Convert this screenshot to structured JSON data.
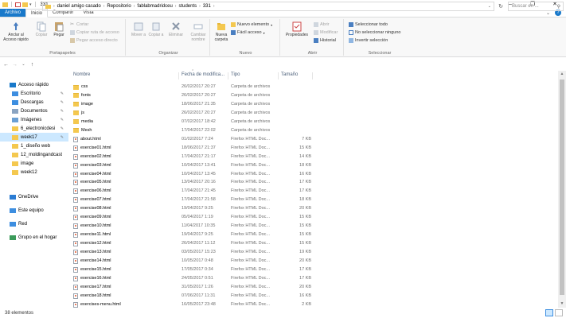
{
  "titlebar": {
    "title": "331",
    "minimize": "–",
    "maximize": "❐",
    "close": "✕"
  },
  "tabs": [
    "Archivo",
    "Inicio",
    "Compartir",
    "Vista"
  ],
  "ribbon": {
    "portapapeles": {
      "label": "Portapapeles",
      "anclar": "Anclar al Acceso rápido",
      "copiar": "Copiar",
      "pegar": "Pegar",
      "cortar": "Cortar",
      "copiar_ruta": "Copiar ruta de acceso",
      "pegar_acceso": "Pegar acceso directo"
    },
    "organizar": {
      "label": "Organizar",
      "mover": "Mover a",
      "copiar": "Copiar a",
      "eliminar": "Eliminar",
      "cambiar": "Cambiar nombre"
    },
    "nuevo": {
      "label": "Nuevo",
      "nueva_carpeta": "Nueva carpeta",
      "nuevo_elemento": "Nuevo elemento",
      "facil_acceso": "Fácil acceso"
    },
    "abrir": {
      "label": "Abrir",
      "propiedades": "Propiedades",
      "abrir": "Abrir",
      "modificar": "Modificar",
      "historial": "Historial"
    },
    "seleccionar": {
      "label": "Seleccionar",
      "todo": "Seleccionar todo",
      "ninguno": "No seleccionar ninguno",
      "invertir": "Invertir selección"
    }
  },
  "address": {
    "crumbs": [
      "daniel amigo casado",
      "Repositorio",
      "fablabmadridceu",
      "students",
      "331"
    ],
    "search_placeholder": "Buscar en ..."
  },
  "nav": [
    {
      "label": "Acceso rápido",
      "icon": "star-icon",
      "pin": false
    },
    {
      "label": "Escritorio",
      "icon": "desktop-icon",
      "pin": true
    },
    {
      "label": "Descargas",
      "icon": "download-icon",
      "pin": true
    },
    {
      "label": "Documentos",
      "icon": "documents-icon",
      "pin": true
    },
    {
      "label": "Imágenes",
      "icon": "pictures-icon",
      "pin": true
    },
    {
      "label": "6_electronicdesi",
      "icon": "folder-icon",
      "pin": true
    },
    {
      "label": "week17",
      "icon": "folder-icon",
      "pin": true,
      "selected": true
    },
    {
      "label": "1_diseño web",
      "icon": "folder-icon",
      "pin": false
    },
    {
      "label": "12_moldingandcast",
      "icon": "folder-icon",
      "pin": false
    },
    {
      "label": "image",
      "icon": "folder-icon",
      "pin": false
    },
    {
      "label": "week12",
      "icon": "folder-icon",
      "pin": false
    },
    {
      "label": "OneDrive",
      "icon": "cloud-icon",
      "pin": false
    },
    {
      "label": "Este equipo",
      "icon": "computer-icon",
      "pin": false
    },
    {
      "label": "Red",
      "icon": "network-icon",
      "pin": false
    },
    {
      "label": "Grupo en el hogar",
      "icon": "homegroup-icon",
      "pin": false
    }
  ],
  "columns": {
    "name": "Nombre",
    "date": "Fecha de modifica...",
    "type": "Tipo",
    "size": "Tamaño"
  },
  "files": [
    {
      "name": "css",
      "date": "26/02/2017 20:27",
      "type": "Carpeta de archivos",
      "size": "",
      "kind": "folder"
    },
    {
      "name": "fonts",
      "date": "26/02/2017 20:27",
      "type": "Carpeta de archivos",
      "size": "",
      "kind": "folder"
    },
    {
      "name": "image",
      "date": "18/06/2017 21:35",
      "type": "Carpeta de archivos",
      "size": "",
      "kind": "folder"
    },
    {
      "name": "js",
      "date": "26/02/2017 20:27",
      "type": "Carpeta de archivos",
      "size": "",
      "kind": "folder"
    },
    {
      "name": "media",
      "date": "07/02/2017 18:42",
      "type": "Carpeta de archivos",
      "size": "",
      "kind": "folder"
    },
    {
      "name": "Mesh",
      "date": "17/04/2017 22:02",
      "type": "Carpeta de archivos",
      "size": "",
      "kind": "folder"
    },
    {
      "name": "about.html",
      "date": "01/02/2017 7:24",
      "type": "Firefox HTML Doc...",
      "size": "7 KB",
      "kind": "html"
    },
    {
      "name": "exercise01.html",
      "date": "18/06/2017 21:37",
      "type": "Firefox HTML Doc...",
      "size": "15 KB",
      "kind": "html"
    },
    {
      "name": "exercise02.html",
      "date": "17/04/2017 21:17",
      "type": "Firefox HTML Doc...",
      "size": "14 KB",
      "kind": "html"
    },
    {
      "name": "exercise03.html",
      "date": "10/04/2017 13:41",
      "type": "Firefox HTML Doc...",
      "size": "18 KB",
      "kind": "html"
    },
    {
      "name": "exercise04.html",
      "date": "10/04/2017 13:45",
      "type": "Firefox HTML Doc...",
      "size": "16 KB",
      "kind": "html"
    },
    {
      "name": "exercise05.html",
      "date": "13/04/2017 20:16",
      "type": "Firefox HTML Doc...",
      "size": "17 KB",
      "kind": "html"
    },
    {
      "name": "exercise06.html",
      "date": "17/04/2017 21:45",
      "type": "Firefox HTML Doc...",
      "size": "17 KB",
      "kind": "html"
    },
    {
      "name": "exercise07.html",
      "date": "17/04/2017 21:58",
      "type": "Firefox HTML Doc...",
      "size": "18 KB",
      "kind": "html"
    },
    {
      "name": "exercise08.html",
      "date": "19/04/2017 9:25",
      "type": "Firefox HTML Doc...",
      "size": "20 KB",
      "kind": "html"
    },
    {
      "name": "exercise09.html",
      "date": "05/04/2017 1:19",
      "type": "Firefox HTML Doc...",
      "size": "15 KB",
      "kind": "html"
    },
    {
      "name": "exercise10.html",
      "date": "11/04/2017 10:35",
      "type": "Firefox HTML Doc...",
      "size": "15 KB",
      "kind": "html"
    },
    {
      "name": "exercise11.html",
      "date": "19/04/2017 9:25",
      "type": "Firefox HTML Doc...",
      "size": "15 KB",
      "kind": "html"
    },
    {
      "name": "exercise12.html",
      "date": "26/04/2017 11:12",
      "type": "Firefox HTML Doc...",
      "size": "15 KB",
      "kind": "html"
    },
    {
      "name": "exercise13.html",
      "date": "03/05/2017 15:23",
      "type": "Firefox HTML Doc...",
      "size": "19 KB",
      "kind": "html"
    },
    {
      "name": "exercise14.html",
      "date": "10/05/2017 0:48",
      "type": "Firefox HTML Doc...",
      "size": "20 KB",
      "kind": "html"
    },
    {
      "name": "exercise15.html",
      "date": "17/05/2017 0:34",
      "type": "Firefox HTML Doc...",
      "size": "17 KB",
      "kind": "html"
    },
    {
      "name": "exercise16.html",
      "date": "24/05/2017 0:51",
      "type": "Firefox HTML Doc...",
      "size": "17 KB",
      "kind": "html"
    },
    {
      "name": "exercise17.html",
      "date": "31/05/2017 1:26",
      "type": "Firefox HTML Doc...",
      "size": "20 KB",
      "kind": "html"
    },
    {
      "name": "exercise18.html",
      "date": "07/06/2017 11:31",
      "type": "Firefox HTML Doc...",
      "size": "16 KB",
      "kind": "html"
    },
    {
      "name": "exercises-menu.html",
      "date": "16/05/2017 23:48",
      "type": "Firefox HTML Doc...",
      "size": "2 KB",
      "kind": "html"
    }
  ],
  "status": {
    "count": "38 elementos"
  },
  "colors": {
    "accent": "#1979ca",
    "folder": "#f4c84f",
    "selected": "#cce8ff"
  }
}
